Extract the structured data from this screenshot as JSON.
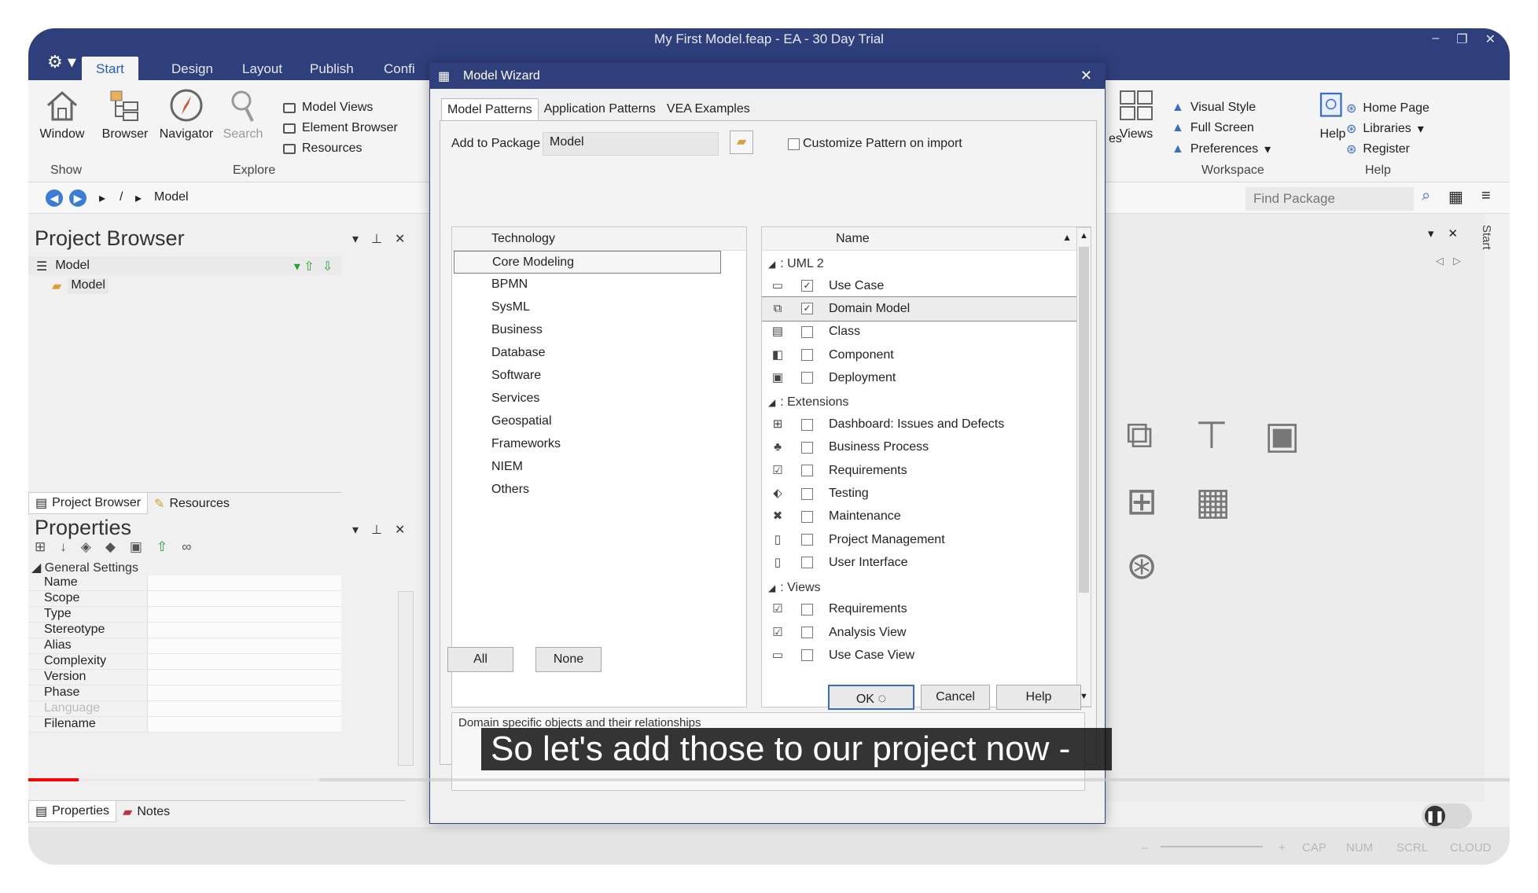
{
  "window": {
    "title": "My First Model.feap - EA - 30 Day Trial",
    "controls": [
      "–",
      "❐",
      "✕"
    ]
  },
  "ribbon": {
    "tabs": [
      "Start",
      "Design",
      "Layout",
      "Publish",
      "Confi"
    ],
    "active_tab": "Start",
    "show_group": {
      "window_label": "Window",
      "group_label": "Show"
    },
    "explore_group": {
      "browser_label": "Browser",
      "navigator_label": "Navigator",
      "search_label": "Search",
      "model_views": "Model Views",
      "element_browser": "Element Browser",
      "resources": "Resources",
      "group_label": "Explore"
    },
    "workspace_group": {
      "views_prefix": "es",
      "views_label": "Views",
      "visual_style": "Visual Style",
      "full_screen": "Full Screen",
      "preferences": "Preferences",
      "group_label": "Workspace"
    },
    "help_group": {
      "help_label": "Help",
      "home_page": "Home Page",
      "libraries": "Libraries",
      "register": "Register",
      "group_label": "Help"
    }
  },
  "address_bar": {
    "root": "/",
    "crumb": "Model",
    "find_package_placeholder": "Find Package"
  },
  "project_browser": {
    "title": "Project Browser",
    "root_label": "Model",
    "child_label": "Model",
    "tabs": [
      "Project Browser",
      "Resources"
    ]
  },
  "properties": {
    "title": "Properties",
    "section": "General Settings",
    "rows": [
      "Name",
      "Scope",
      "Type",
      "Stereotype",
      "Alias",
      "Complexity",
      "Version",
      "Phase",
      "Language",
      "Filename"
    ],
    "tabs": [
      "Properties",
      "Notes"
    ]
  },
  "right_panel": {
    "side_tab": "Start"
  },
  "dialog": {
    "title": "Model Wizard",
    "close": "✕",
    "tabs": [
      "Model Patterns",
      "Application Patterns",
      "VEA Examples"
    ],
    "active_tab": "Model Patterns",
    "add_to_package_label": "Add to Package",
    "add_to_package_value": "Model",
    "customize_label": "Customize Pattern on import",
    "technology_header": "Technology",
    "technologies": [
      "Core Modeling",
      "BPMN",
      "SysML",
      "Business",
      "Database",
      "Software",
      "Services",
      "Geospatial",
      "Frameworks",
      "NIEM",
      "Others"
    ],
    "selected_technology": "Core Modeling",
    "name_header": "Name",
    "groups": [
      {
        "label": ": UML 2",
        "items": [
          {
            "name": "Use Case",
            "checked": true,
            "icon": "use-case-icon",
            "glyph": "▭"
          },
          {
            "name": "Domain Model",
            "checked": true,
            "icon": "domain-model-icon",
            "glyph": "⧉",
            "selected": true
          },
          {
            "name": "Class",
            "checked": false,
            "icon": "class-icon",
            "glyph": "▤"
          },
          {
            "name": "Component",
            "checked": false,
            "icon": "component-icon",
            "glyph": "◧"
          },
          {
            "name": "Deployment",
            "checked": false,
            "icon": "deployment-icon",
            "glyph": "▣"
          }
        ]
      },
      {
        "label": ": Extensions",
        "items": [
          {
            "name": "Dashboard: Issues and Defects",
            "checked": false,
            "icon": "dashboard-icon",
            "glyph": "⊞"
          },
          {
            "name": "Business Process",
            "checked": false,
            "icon": "business-process-icon",
            "glyph": "♣"
          },
          {
            "name": "Requirements",
            "checked": false,
            "icon": "requirements-icon",
            "glyph": "☑"
          },
          {
            "name": "Testing",
            "checked": false,
            "icon": "testing-icon",
            "glyph": "⬖"
          },
          {
            "name": "Maintenance",
            "checked": false,
            "icon": "maintenance-icon",
            "glyph": "✖"
          },
          {
            "name": "Project Management",
            "checked": false,
            "icon": "project-management-icon",
            "glyph": "▯"
          },
          {
            "name": "User Interface",
            "checked": false,
            "icon": "user-interface-icon",
            "glyph": "▯"
          }
        ]
      },
      {
        "label": ": Views",
        "items": [
          {
            "name": "Requirements",
            "checked": false,
            "icon": "requirements-view-icon",
            "glyph": "☑"
          },
          {
            "name": "Analysis View",
            "checked": false,
            "icon": "analysis-view-icon",
            "glyph": "☑"
          },
          {
            "name": "Use Case View",
            "checked": false,
            "icon": "use-case-view-icon",
            "glyph": "▭"
          }
        ]
      }
    ],
    "description": "Domain specific objects and their relationships",
    "all_button": "All",
    "none_button": "None",
    "ok_button": "OK",
    "cancel_button": "Cancel",
    "help_button": "Help"
  },
  "caption": "So let's add those to our project now -",
  "status_bar": {
    "items": [
      "CAP",
      "NUM",
      "SCRL",
      "CLOUD"
    ]
  },
  "video": {
    "progress_fraction": 0.034
  },
  "colors": {
    "title_bar": "#2f3f7c",
    "accent": "#2a5db0",
    "progress_played": "#ff0000"
  }
}
